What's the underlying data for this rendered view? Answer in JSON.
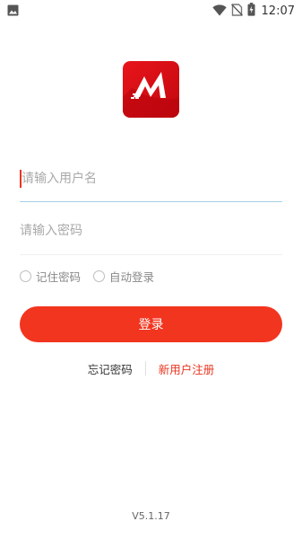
{
  "status_bar": {
    "time": "12:07"
  },
  "login": {
    "username_placeholder": "请输入用户名",
    "password_placeholder": "请输入密码",
    "remember_password_label": "记住密码",
    "auto_login_label": "自动登录",
    "login_button_label": "登录",
    "forgot_password_label": "忘记密码",
    "register_label": "新用户注册"
  },
  "footer": {
    "version": "V5.1.17"
  },
  "colors": {
    "accent": "#f2351f",
    "link_red": "#e8361f",
    "focus_line": "#a8cfe6"
  },
  "icons": [
    "image-icon",
    "wifi-icon",
    "no-sim-icon",
    "battery-icon",
    "app-logo-icon"
  ]
}
